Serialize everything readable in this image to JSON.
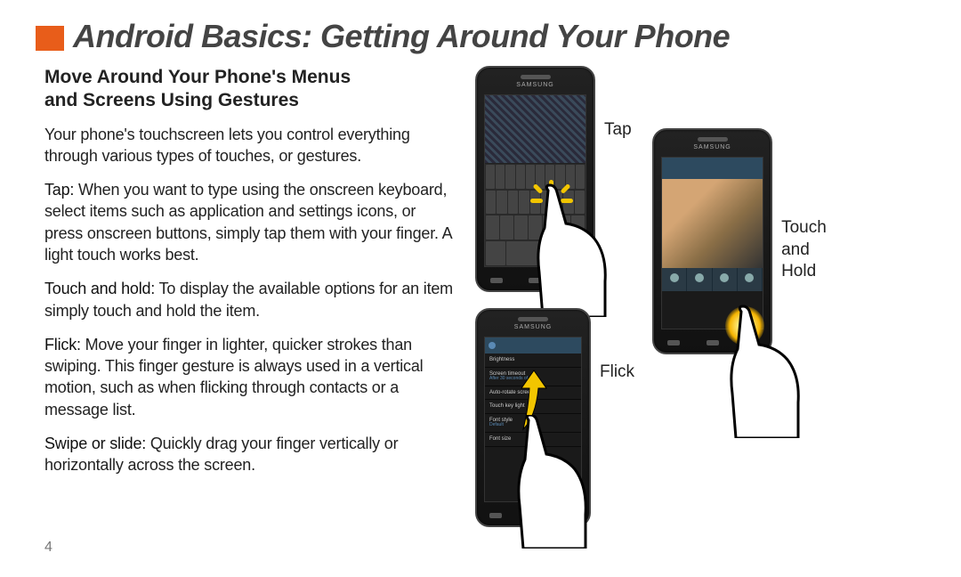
{
  "title": "Android Basics: Getting Around Your Phone",
  "subhead_line1": "Move Around Your Phone's Menus",
  "subhead_line2": "and Screens Using Gestures",
  "intro": "Your phone's touchscreen lets you control everything through various types of touches, or gestures.",
  "tap_term": "Tap:",
  "tap_text": " When you want to type using the onscreen keyboard, select items such as application and settings icons, or press onscreen buttons, simply tap them with your finger. A light touch works best.",
  "touchhold_term": "Touch and hold:",
  "touchhold_text": " To display the available options for an item simply touch and hold the item.",
  "flick_term": "Flick:",
  "flick_text": " Move your finger in lighter, quicker strokes than swiping. This finger gesture is always used in a vertical motion, such as when flicking through contacts or a message list.",
  "swipe_term": "Swipe or slide:",
  "swipe_text": " Quickly drag your finger vertically or horizontally across the screen.",
  "page_number": "4",
  "labels": {
    "tap": "Tap",
    "touch_hold_1": "Touch",
    "touch_hold_2": "and",
    "touch_hold_3": "Hold",
    "flick": "Flick"
  },
  "phone_brand": "SAMSUNG",
  "settings_items": [
    {
      "t": "Brightness",
      "s": ""
    },
    {
      "t": "Screen timeout",
      "s": "After 30 seconds of inact"
    },
    {
      "t": "Auto-rotate screen",
      "s": ""
    },
    {
      "t": "Touch key light",
      "s": ""
    },
    {
      "t": "Font style",
      "s": "Default"
    },
    {
      "t": "Font size",
      "s": ""
    }
  ]
}
